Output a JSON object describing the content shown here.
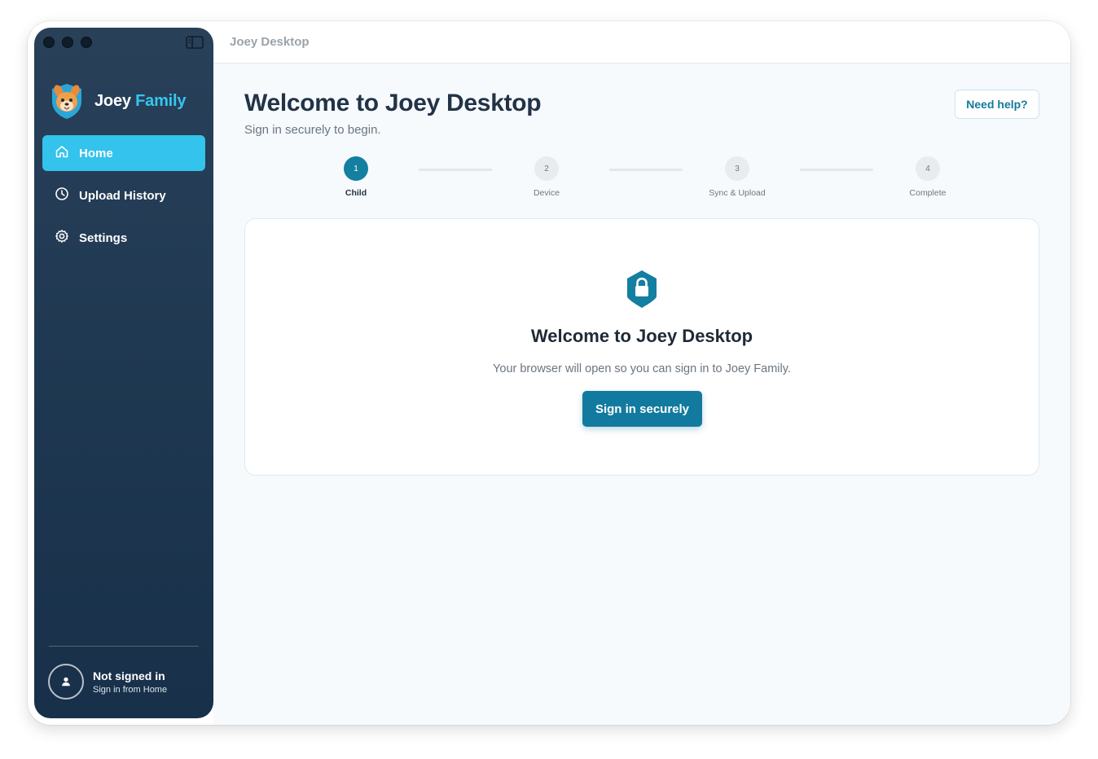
{
  "window": {
    "title": "Joey Desktop"
  },
  "sidebar": {
    "brand": {
      "joey": "Joey",
      "family": "Family"
    },
    "items": [
      {
        "label": "Home",
        "icon": "home-icon",
        "active": true
      },
      {
        "label": "Upload History",
        "icon": "clock-icon",
        "active": false
      },
      {
        "label": "Settings",
        "icon": "gear-icon",
        "active": false
      }
    ],
    "account": {
      "status": "Not signed in",
      "hint": "Sign in from Home",
      "icon": "user-icon"
    }
  },
  "main": {
    "title": "Welcome to Joey Desktop",
    "subtitle": "Sign in securely to begin.",
    "help_label": "Need help?",
    "steps": [
      {
        "number": "1",
        "label": "Child",
        "active": true
      },
      {
        "number": "2",
        "label": "Device",
        "active": false
      },
      {
        "number": "3",
        "label": "Sync & Upload",
        "active": false
      },
      {
        "number": "4",
        "label": "Complete",
        "active": false
      }
    ],
    "card": {
      "icon": "shield-lock-icon",
      "title": "Welcome to Joey Desktop",
      "text": "Your browser will open so you can sign in to Joey Family.",
      "button_label": "Sign in securely"
    }
  },
  "colors": {
    "sidebar_bg": "#1f3851",
    "accent": "#33c3ec",
    "primary": "#137a9f",
    "brand_family": "#35c6ef"
  }
}
